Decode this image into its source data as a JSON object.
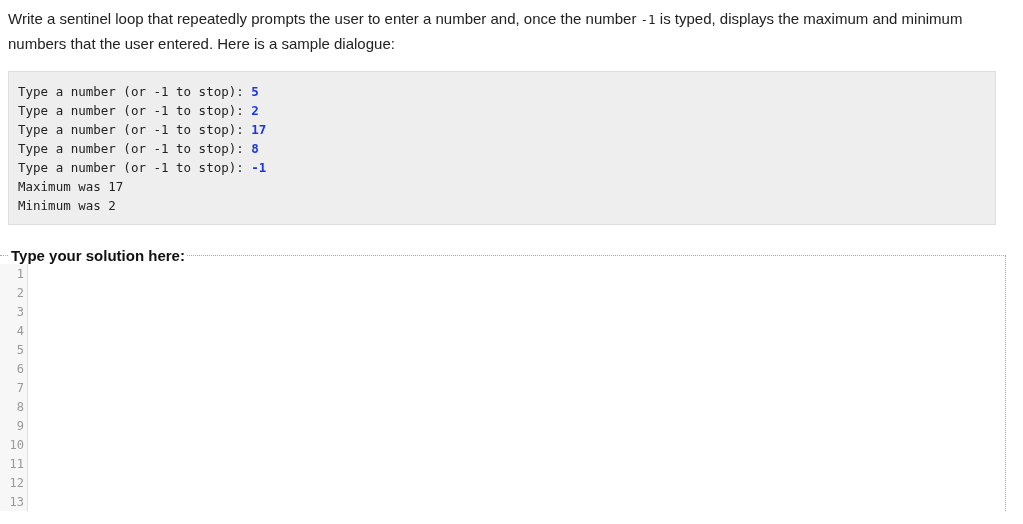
{
  "prompt": {
    "before": "Write a sentinel loop that repeatedly prompts the user to enter a number and, once the number ",
    "code": "-1",
    "after": " is typed, displays the maximum and minimum numbers that the user entered. Here is a sample dialogue:"
  },
  "dialogue": [
    {
      "kind": "prompt",
      "text": "Type a number (or -1 to stop): ",
      "input": "5"
    },
    {
      "kind": "prompt",
      "text": "Type a number (or -1 to stop): ",
      "input": "2"
    },
    {
      "kind": "prompt",
      "text": "Type a number (or -1 to stop): ",
      "input": "17"
    },
    {
      "kind": "prompt",
      "text": "Type a number (or -1 to stop): ",
      "input": "8"
    },
    {
      "kind": "prompt",
      "text": "Type a number (or -1 to stop): ",
      "input": "-1"
    },
    {
      "kind": "output",
      "text": "Maximum was 17"
    },
    {
      "kind": "output",
      "text": "Minimum was 2"
    }
  ],
  "solution": {
    "legend": "Type your solution here:",
    "line_numbers": [
      "1",
      "2",
      "3",
      "4",
      "5",
      "6",
      "7",
      "8",
      "9",
      "10",
      "11",
      "12",
      "13"
    ]
  }
}
